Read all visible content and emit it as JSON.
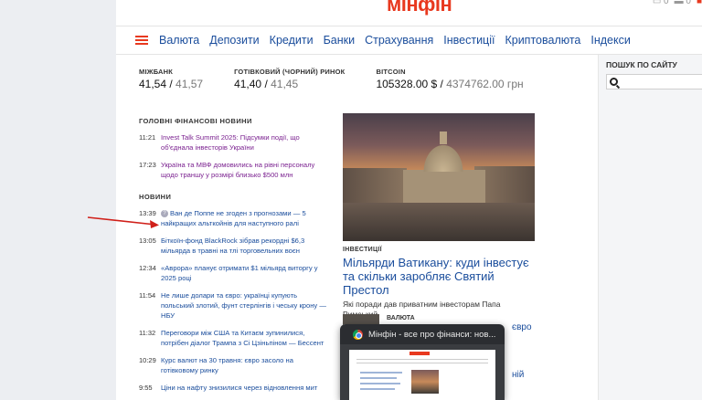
{
  "header": {
    "logo": "мінфін",
    "icons": [
      "wallet-icon",
      "bell-icon"
    ]
  },
  "nav": {
    "items": [
      "Валюта",
      "Депозити",
      "Кредити",
      "Банки",
      "Страхування",
      "Інвестиції",
      "Криптовалюта",
      "Індекси"
    ]
  },
  "rates": [
    {
      "label": "МІЖБАНК",
      "buy": "41,54",
      "sep": " / ",
      "sell": "41,57"
    },
    {
      "label": "ГОТІВКОВИЙ (ЧОРНИЙ) РИНОК",
      "buy": "41,40",
      "sep": " / ",
      "sell": "41,45"
    },
    {
      "label": "BITCOIN",
      "buy": "105328.00 $",
      "sep": " / ",
      "sell": "4374762.00 грн"
    }
  ],
  "search": {
    "label": "ПОШУК ПО САЙТУ",
    "placeholder": ""
  },
  "main_news": {
    "title": "ГОЛОВНІ ФІНАНСОВІ НОВИНИ",
    "items": [
      {
        "time": "11:21",
        "headline": "Invest Talk Summit 2025: Підсумки події, що об'єднала інвесторів України"
      },
      {
        "time": "17:23",
        "headline": "Україна та МВФ домовились на рівні персоналу щодо траншу у розмірі близько $500 млн"
      }
    ]
  },
  "news": {
    "title": "НОВИНИ",
    "items": [
      {
        "time": "13:39",
        "badge": "?",
        "headline": "Ван де Поппе не згоден з прогнозами — 5 найкращих альткойнів для наступного ралі"
      },
      {
        "time": "13:05",
        "headline": "Біткоїн-фонд BlackRock зібрав рекордні $6,3 мільярда в травні на тлі торговельних воєн"
      },
      {
        "time": "12:34",
        "headline": "«Аврора» планує отримати $1 мільярд виторгу у 2025 році"
      },
      {
        "time": "11:54",
        "headline": "Не лише долари та євро: українці купують польський злотий, фунт стерлінгів і чеську крону — НБУ"
      },
      {
        "time": "11:32",
        "headline": "Переговори між США та Китаєм зупинилися, потрібен діалог Трампа з Сі Цзіньпіном — Бессент"
      },
      {
        "time": "10:29",
        "headline": "Курс валют на 30 травня: євро засоло на готівковому ринку"
      },
      {
        "time": "9:55",
        "headline": "Ціни на нафту знизилися через відновлення мит"
      }
    ]
  },
  "feature": {
    "tag": "ІНВЕСТИЦІЇ",
    "title": "Мільярди Ватикану: куди інвестує та скільки заробляє Святий Престол",
    "subtitle": "Які поради дав приватним інвесторам Папа Римський"
  },
  "secondary": {
    "tag": "ВАЛЮТА",
    "frag1": "євро",
    "frag2": "ній"
  },
  "tab_preview": {
    "title": "Мінфін - все про фінанси: нов..."
  }
}
